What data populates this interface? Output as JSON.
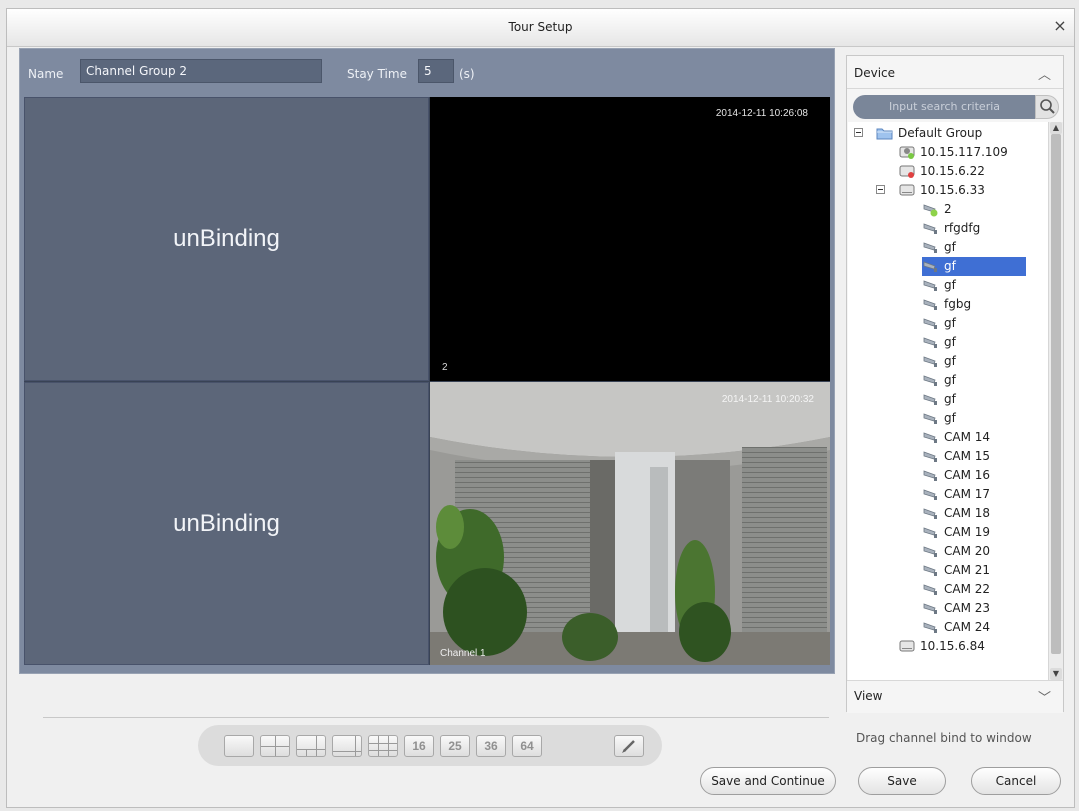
{
  "window": {
    "title": "Tour Setup",
    "close_glyph": "×"
  },
  "name_label": "Name",
  "name_value": "Channel Group 2",
  "stay_label": "Stay Time",
  "stay_value": "5",
  "stay_unit": "(s)",
  "cells": {
    "c1": {
      "text": "unBinding"
    },
    "c2": {
      "timestamp": "2014-12-11 10:26:08",
      "channel": "2"
    },
    "c3": {
      "text": "unBinding"
    },
    "c4": {
      "timestamp": "2014-12-11 10:20:32",
      "channel": "Channel 1"
    }
  },
  "layout_buttons": [
    {
      "name": "layout-1-button",
      "label": ""
    },
    {
      "name": "layout-4-button",
      "label": ""
    },
    {
      "name": "layout-6-button",
      "label": ""
    },
    {
      "name": "layout-8-button",
      "label": ""
    },
    {
      "name": "layout-9-button",
      "label": ""
    },
    {
      "name": "layout-16-button",
      "label": "16"
    },
    {
      "name": "layout-25-button",
      "label": "25"
    },
    {
      "name": "layout-36-button",
      "label": "36"
    },
    {
      "name": "layout-64-button",
      "label": "64"
    },
    {
      "name": "layout-custom-button",
      "label": ""
    }
  ],
  "device_panel": {
    "title": "Device",
    "search_placeholder": "Input search criteria",
    "view_title": "View",
    "hint": "Drag channel bind to window",
    "tree": [
      {
        "label": "Default Group",
        "icon": "folder-icon",
        "level": 0,
        "expander": "minus"
      },
      {
        "label": "10.15.117.109",
        "icon": "device-online-icon",
        "level": 1
      },
      {
        "label": "10.15.6.22",
        "icon": "device-offline-icon",
        "level": 1
      },
      {
        "label": "10.15.6.33",
        "icon": "device-icon",
        "level": 1,
        "expander": "minus"
      },
      {
        "label": "2",
        "icon": "camera-active-icon",
        "level": 2
      },
      {
        "label": "rfgdfg",
        "icon": "camera-icon",
        "level": 2
      },
      {
        "label": "gf",
        "icon": "camera-icon",
        "level": 2
      },
      {
        "label": "gf",
        "icon": "camera-icon",
        "level": 2,
        "selected": true
      },
      {
        "label": "gf",
        "icon": "camera-icon",
        "level": 2
      },
      {
        "label": "fgbg",
        "icon": "camera-icon",
        "level": 2
      },
      {
        "label": "gf",
        "icon": "camera-icon",
        "level": 2
      },
      {
        "label": "gf",
        "icon": "camera-icon",
        "level": 2
      },
      {
        "label": "gf",
        "icon": "camera-icon",
        "level": 2
      },
      {
        "label": "gf",
        "icon": "camera-icon",
        "level": 2
      },
      {
        "label": "gf",
        "icon": "camera-icon",
        "level": 2
      },
      {
        "label": "gf",
        "icon": "camera-icon",
        "level": 2
      },
      {
        "label": "CAM 14",
        "icon": "camera-icon",
        "level": 2
      },
      {
        "label": "CAM 15",
        "icon": "camera-icon",
        "level": 2
      },
      {
        "label": "CAM 16",
        "icon": "camera-icon",
        "level": 2
      },
      {
        "label": "CAM 17",
        "icon": "camera-icon",
        "level": 2
      },
      {
        "label": "CAM 18",
        "icon": "camera-icon",
        "level": 2
      },
      {
        "label": "CAM 19",
        "icon": "camera-icon",
        "level": 2
      },
      {
        "label": "CAM 20",
        "icon": "camera-icon",
        "level": 2
      },
      {
        "label": "CAM 21",
        "icon": "camera-icon",
        "level": 2
      },
      {
        "label": "CAM 22",
        "icon": "camera-icon",
        "level": 2
      },
      {
        "label": "CAM 23",
        "icon": "camera-icon",
        "level": 2
      },
      {
        "label": "CAM 24",
        "icon": "camera-icon",
        "level": 2
      },
      {
        "label": "10.15.6.84",
        "icon": "device-icon",
        "level": 1
      }
    ]
  },
  "buttons": {
    "save_continue": "Save and Continue",
    "save": "Save",
    "cancel": "Cancel"
  },
  "colors": {
    "panel": "#7e8aa0",
    "unbound_cell": "#5c6679",
    "selection": "#3f6fd4",
    "search_box": "#7a8699"
  }
}
